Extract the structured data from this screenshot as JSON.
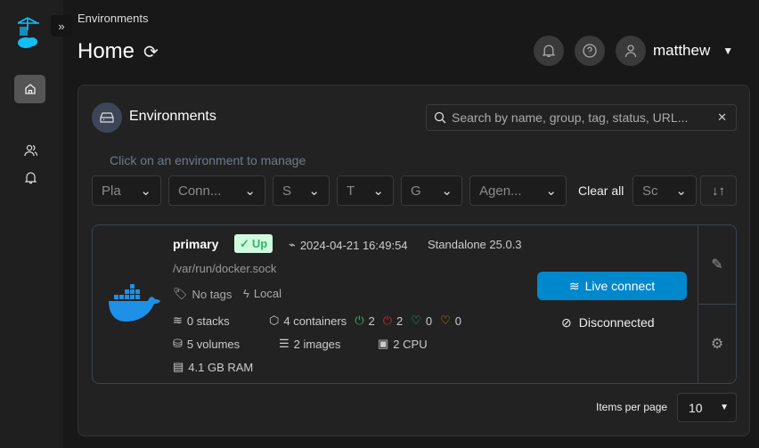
{
  "header": {
    "breadcrumb": "Environments",
    "title": "Home",
    "user": "matthew"
  },
  "panel": {
    "title": "Environments",
    "search_placeholder": "Search by name, group, tag, status, URL...",
    "hint": "Click on an environment to manage",
    "filters": [
      "Pla",
      "Conn...",
      "S",
      "T",
      "G",
      "Agen..."
    ],
    "clear_all": "Clear all",
    "sort": "Sc"
  },
  "environment": {
    "name": "primary",
    "status": "Up",
    "heartbeat": "2024-04-21 16:49:54",
    "type": "Standalone 25.0.3",
    "url": "/var/run/docker.sock",
    "tags": "No tags",
    "location": "Local",
    "stacks": "0 stacks",
    "containers": "4 containers",
    "running": "2",
    "stopped": "2",
    "healthy": "0",
    "unhealthy": "0",
    "volumes": "5 volumes",
    "images": "2 images",
    "cpu": "2 CPU",
    "ram": "4.1 GB RAM",
    "live_connect": "Live connect",
    "connection": "Disconnected"
  },
  "pagination": {
    "label": "Items per page",
    "value": "10"
  },
  "colors": {
    "accent": "#0088cc",
    "docker": "#1d91e6",
    "up_badge": "#d1fadf",
    "running": "#2eb867",
    "stopped": "#c62828",
    "unhealthy": "#e8900c"
  }
}
